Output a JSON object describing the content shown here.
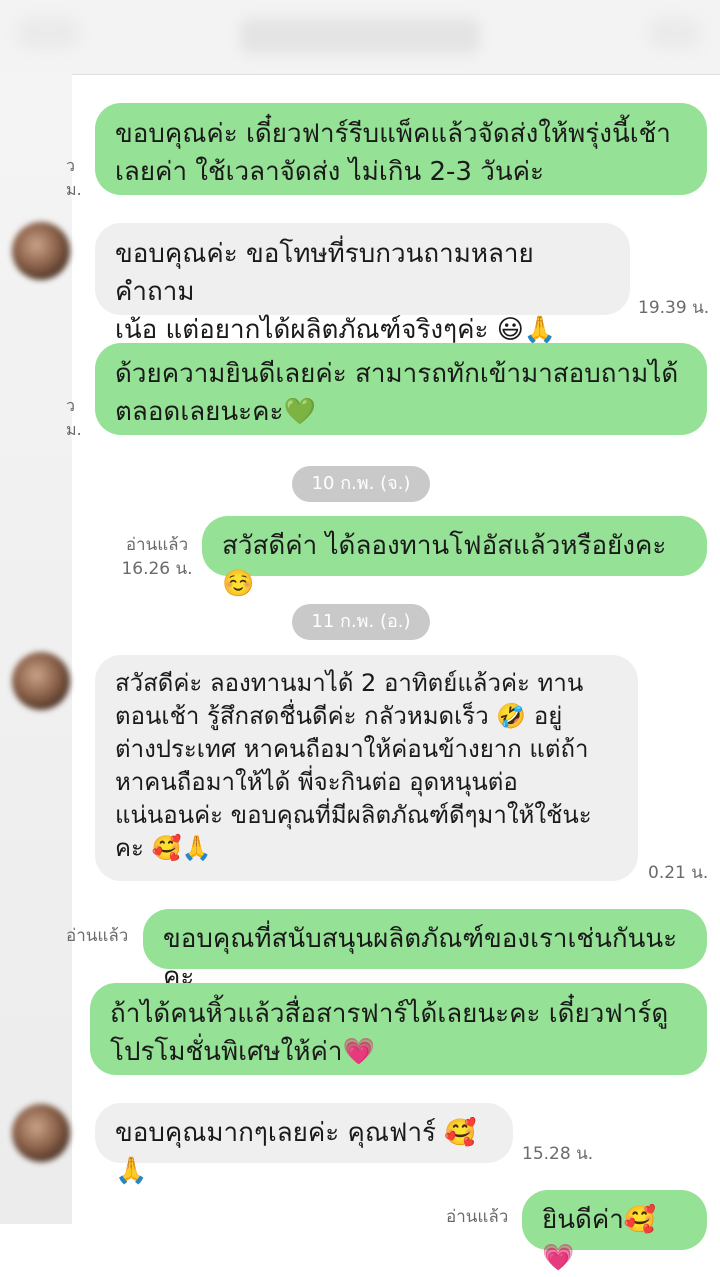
{
  "messages": [
    {
      "side": "out",
      "text": "ขอบคุณค่ะ เดี๋ยวฟาร์รีบแพ็คแล้วจัดส่งให้พรุ่งนี้เช้า\nเลยค่า ใช้เวลาจัดส่ง ไม่เกิน 2-3 วันค่ะ"
    },
    {
      "side": "in",
      "text": "ขอบคุณค่ะ ขอโทษที่รบกวนถามหลายคำถาม\nเน้อ แต่อยากได้ผลิตภัณฑ์จริงๆค่ะ 😃🙏",
      "time": "19.39 น."
    },
    {
      "side": "out",
      "text": "ด้วยความยินดีเลยค่ะ สามารถทักเข้ามาสอบถามได้\nตลอดเลยนะคะ💚"
    },
    {
      "side": "out",
      "text": "สวัสดีค่า ได้ลองทานโฟอัสแล้วหรือยังคะ☺️",
      "read": "อ่านแล้ว",
      "time": "16.26 น."
    },
    {
      "side": "in",
      "text": "สวัสดีค่ะ ลองทานมาได้ 2 อาทิตย์แล้วค่ะ ทาน\nตอนเช้า  รู้สึกสดชื่นดีค่ะ กลัวหมดเร็ว 🤣 อยู่\nต่างประเทศ หาคนถือมาให้ค่อนข้างยาก แต่ถ้า\nหาคนถือมาให้ได้ พี่จะกินต่อ อุดหนุนต่อ\nแน่นอนค่ะ ขอบคุณที่มีผลิตภัณฑ์ดีๆมาให้ใช้นะ\nคะ 🥰🙏",
      "time": "0.21 น."
    },
    {
      "side": "out",
      "text": "ขอบคุณที่สนับสนุนผลิตภัณฑ์ของเราเช่นกันนะคะ",
      "read": "อ่านแล้ว"
    },
    {
      "side": "out",
      "text": "ถ้าได้คนหิ้วแล้วสื่อสารฟาร์ได้เลยนะคะ เดี๋ยวฟาร์ดู\nโปรโมชั่นพิเศษให้ค่า💗"
    },
    {
      "side": "in",
      "text": "ขอบคุณมากๆเลยค่ะ คุณฟาร์ 🥰🙏",
      "time": "15.28 น."
    },
    {
      "side": "out",
      "text": "ยินดีค่า🥰💗",
      "read": "อ่านแล้ว"
    }
  ],
  "dates": [
    "10 ก.พ. (จ.)",
    "11 ก.พ. (อ.)"
  ],
  "colors": {
    "outgoing": "#95e195",
    "incoming": "#efefef",
    "date_pill": "#c9c9c9"
  }
}
